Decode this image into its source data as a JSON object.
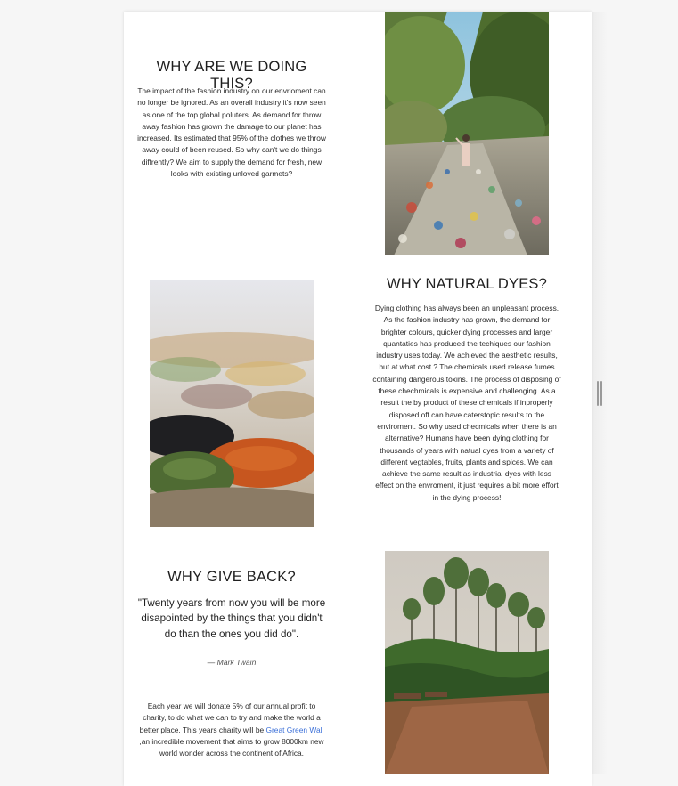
{
  "sections": {
    "doing": {
      "title": "WHY ARE WE DOING THIS?",
      "body": "The impact of the fashion industry on our envrioment can no longer be ignored. As an overall industry it's now seen as one of the top global poluters. As demand for throw away fashion has grown the damage to our planet has increased. Its estimated that 95% of the clothes we throw away could of been reused. So why can't we do things diffrently? We aim to supply the demand for fresh, new looks with existing unloved garmets?"
    },
    "dyes": {
      "title": "WHY NATURAL DYES?",
      "body": "Dying clothing has always been an unpleasant process. As the fashion industry has grown, the demand for brighter colours, quicker dying processes and larger quantaties has produced the techiques our fashion industry uses today. We achieved the aesthetic results, but at what cost ? The chemicals used release fumes containing dangerous toxins. The process of disposing of these chechmicals is expensive and challenging. As a result the by product of these chemicals if inproperly disposed off can have caterstopic results to the enviroment. So why used checmicals when there is an alternative? Humans have been dying clothing for thousands of years with natual dyes from a variety of different vegtables, fruits, plants and spices. We can achieve the same result as industrial dyes with less effect on the envroment, it just requires a bit more effort in the dying process!"
    },
    "give_back": {
      "title": "WHY GIVE BACK?",
      "quote": "\"Twenty years from now you will be more disapointed by the things that you didn't do than the ones you did do\".",
      "attribution": "— Mark Twain",
      "body_before_link": "Each year we will donate 5% of our annual profit to charity, to do what we can to try and make the world a better place. This years charity will be ",
      "link_text": "Great Green Wall",
      "body_after_link": " ,an incredible movement that aims to grow 8000km new world wonder across the continent of Africa."
    }
  },
  "images": {
    "pollution": "photo of woman standing on a path covered in plastic waste in a forest",
    "spices": "close-up photo of colourful spice piles",
    "trees": "photo of tall trees beside a cleared red-earth patch"
  },
  "colors": {
    "page": "#ffffff",
    "background": "#f6f6f6",
    "heading": "#1f1f1f",
    "link": "#3a6fd8"
  }
}
